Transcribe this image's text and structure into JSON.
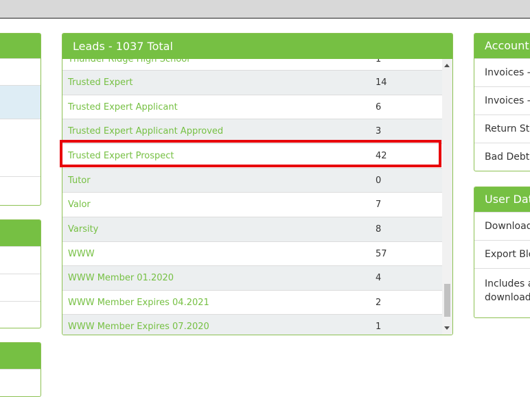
{
  "leads_panel": {
    "title": "Leads - 1037 Total",
    "partial_row": {
      "name": "Thunder Ridge High School",
      "count": "1"
    },
    "rows": [
      {
        "name": "Trusted Expert",
        "count": "14"
      },
      {
        "name": "Trusted Expert Applicant",
        "count": "6"
      },
      {
        "name": "Trusted Expert Applicant Approved",
        "count": "3"
      },
      {
        "name": "Trusted Expert Prospect",
        "count": "42"
      },
      {
        "name": "Tutor",
        "count": "0"
      },
      {
        "name": "Valor",
        "count": "7"
      },
      {
        "name": "Varsity",
        "count": "8"
      },
      {
        "name": "WWW",
        "count": "57"
      },
      {
        "name": "WWW Member 01.2020",
        "count": "4"
      },
      {
        "name": "WWW Member Expires 04.2021",
        "count": "2"
      },
      {
        "name": "WWW Member Expires 07.2020",
        "count": "1"
      }
    ],
    "highlighted_row": "Trusted Expert Prospect"
  },
  "accounting_panel": {
    "title": "Accountin",
    "items": [
      "Invoices - C",
      "Invoices - I",
      "Return Sta",
      "Bad Debt I"
    ]
  },
  "user_data_panel": {
    "title": "User Dat",
    "items": [
      "Download",
      "Export Blo"
    ],
    "note_lines": [
      "Includes a",
      "download"
    ]
  },
  "colors": {
    "header_green": "#76c043",
    "link_green": "#76c043",
    "highlight_red": "#e8000b",
    "selected_row": "#deedf5"
  }
}
